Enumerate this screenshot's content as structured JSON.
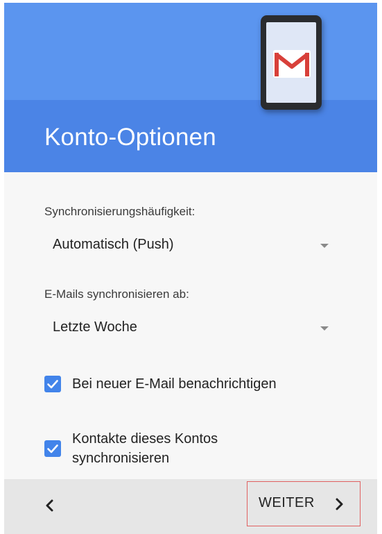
{
  "header": {
    "title": "Konto-Optionen",
    "illustration_icon": "gmail-icon",
    "colors": {
      "header_bottom": "#4b84e6",
      "header_top": "#5b95ef",
      "gmail_red": "#d8403a"
    }
  },
  "form": {
    "sync_frequency": {
      "label": "Synchronisierungshäufigkeit:",
      "value": "Automatisch (Push)"
    },
    "sync_since": {
      "label": "E-Mails synchronisieren ab:",
      "value": "Letzte Woche"
    },
    "notify_checkbox": {
      "label": "Bei neuer E-Mail benachrichtigen",
      "checked": true
    },
    "contacts_checkbox": {
      "label_line1": "Kontakte dieses Kontos",
      "label_line2": "synchronisieren",
      "checked": true
    },
    "accent_color": "#4284ea"
  },
  "footer": {
    "back_icon": "chevron-left-icon",
    "next_label": "WEITER",
    "next_icon": "chevron-right-icon",
    "highlight_color": "#e06060"
  }
}
